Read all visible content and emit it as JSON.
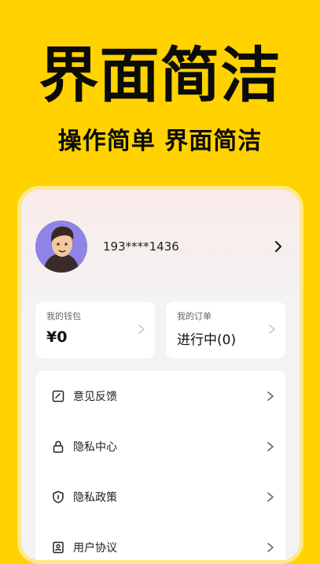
{
  "hero": {
    "title": "界面简洁",
    "subtitle": "操作简单 界面简洁"
  },
  "profile": {
    "phone": "193****1436"
  },
  "cards": [
    {
      "label": "我的钱包",
      "value": "¥0"
    },
    {
      "label": "我的订单",
      "value": "进行中(0)"
    }
  ],
  "menu": [
    {
      "label": "意见反馈",
      "icon": "feedback-icon"
    },
    {
      "label": "隐私中心",
      "icon": "lock-icon"
    },
    {
      "label": "隐私政策",
      "icon": "shield-icon"
    },
    {
      "label": "用户协议",
      "icon": "user-agreement-icon"
    }
  ],
  "colors": {
    "background": "#FFD200",
    "text": "#0b0b0b",
    "avatar": "#8e84e6"
  }
}
